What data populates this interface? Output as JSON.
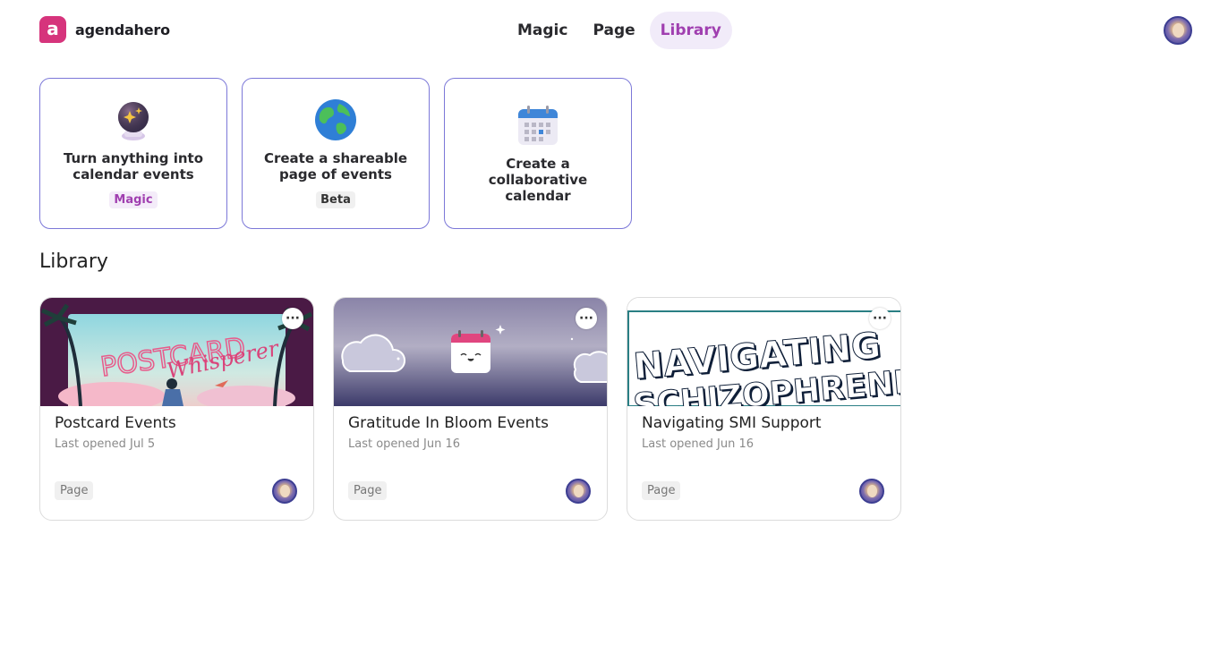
{
  "brand": {
    "logo_letter": "a",
    "name": "agendahero",
    "accent": "#d6347c"
  },
  "nav": {
    "items": [
      {
        "label": "Magic",
        "active": false
      },
      {
        "label": "Page",
        "active": false
      },
      {
        "label": "Library",
        "active": true
      }
    ]
  },
  "actions": [
    {
      "title": "Turn anything into calendar events",
      "badge": "Magic",
      "icon": "crystal-ball-icon"
    },
    {
      "title": "Create a shareable page of events",
      "badge": "Beta",
      "icon": "globe-icon"
    },
    {
      "title": "Create a collaborative calendar",
      "badge": "",
      "icon": "calendar-icon"
    }
  ],
  "library": {
    "title": "Library",
    "items": [
      {
        "title": "Postcard Events",
        "subtitle": "Last opened Jul 5",
        "type": "Page",
        "cover_text": "POSTCARD",
        "cover_script": "Whisperer"
      },
      {
        "title": "Gratitude In Bloom Events",
        "subtitle": "Last opened Jun 16",
        "type": "Page"
      },
      {
        "title": "Navigating SMI Support",
        "subtitle": "Last opened Jun 16",
        "type": "Page",
        "cover_line1": "NAVIGATING",
        "cover_line2": "SCHIZOPHRENIA"
      }
    ]
  },
  "more_label": "···",
  "colors": {
    "accent_purple": "#a03fb0",
    "card_border": "#7c78d8"
  }
}
